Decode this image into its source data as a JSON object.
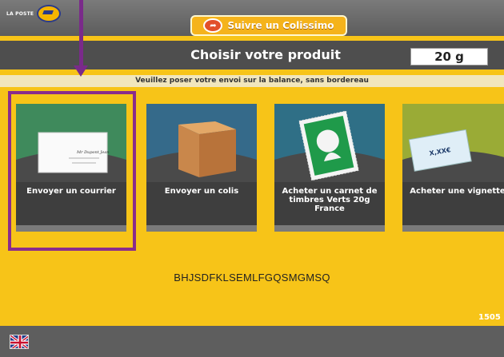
{
  "header": {
    "logo_text": "LA POSTE",
    "colissimo_button": "Suivre un Colissimo"
  },
  "title_bar": {
    "title": "Choisir votre produit",
    "weight": "20 g"
  },
  "instruction": "Veuillez poser votre envoi sur la balance, sans bordereau",
  "products": [
    {
      "label": "Envoyer un courrier",
      "icon": "letter-icon"
    },
    {
      "label": "Envoyer un colis",
      "icon": "parcel-box-icon"
    },
    {
      "label": "Acheter un carnet de timbres Verts 20g France",
      "icon": "green-stamp-icon"
    },
    {
      "label": "Acheter une vignette",
      "icon": "vignette-label-icon"
    }
  ],
  "code": "BHJSDFKLSEMLFGQSMGMSQ",
  "counter": "1505",
  "language_flag": "uk-flag-icon",
  "envelope_text": "Mr Dupont Jean",
  "vignette_text": "X,XX€",
  "colors": {
    "background": "#f7c418",
    "bars": "#4e4e4e",
    "highlight": "#8a2c8c"
  }
}
